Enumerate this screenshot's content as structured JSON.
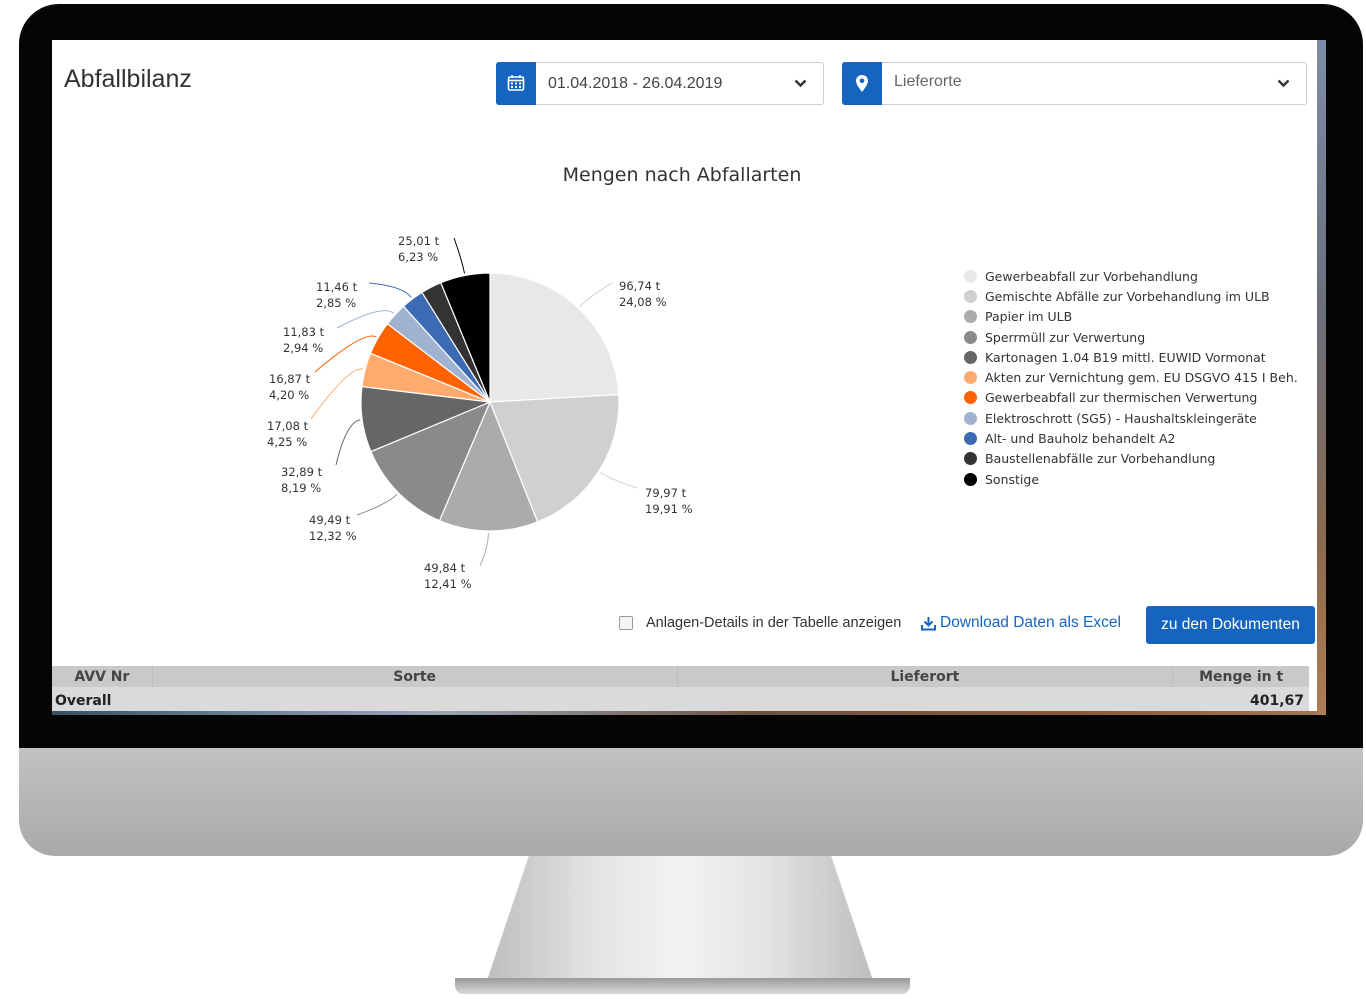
{
  "header": {
    "title": "Abfallbilanz",
    "date_range": "01.04.2018 - 26.04.2019",
    "location_placeholder": "Lieferorte"
  },
  "icons": {
    "date": "calendar-icon",
    "location": "map-pin-icon",
    "dropdown": "chevron-down-icon",
    "download": "download-icon"
  },
  "chart_data": {
    "type": "pie",
    "title": "Mengen nach Abfallarten",
    "legend_position": "right",
    "series": [
      {
        "name": "Gewerbeabfall zur Vorbehandlung",
        "value": 96.74,
        "label_value": "96,74 t",
        "label_percent": "24,08 %",
        "color": "#e8e8e8"
      },
      {
        "name": "Gemischte Abfälle zur Vorbehandlung im ULB",
        "value": 79.97,
        "label_value": "79,97 t",
        "label_percent": "19,91 %",
        "color": "#d0d0d0"
      },
      {
        "name": "Papier im ULB",
        "value": 49.84,
        "label_value": "49,84 t",
        "label_percent": "12,41 %",
        "color": "#ababab"
      },
      {
        "name": "Sperrmüll zur Verwertung",
        "value": 49.49,
        "label_value": "49,49 t",
        "label_percent": "12,32 %",
        "color": "#8a8a8a"
      },
      {
        "name": "Kartonagen 1.04 B19 mittl. EUWID Vormonat",
        "value": 32.89,
        "label_value": "32,89 t",
        "label_percent": "8,19 %",
        "color": "#666666"
      },
      {
        "name": "Akten zur Vernichtung gem. EU DSGVO 415 I Beh.",
        "value": 17.08,
        "label_value": "17,08 t",
        "label_percent": "4,25 %",
        "color": "#ffab70"
      },
      {
        "name": "Gewerbeabfall zur thermischen Verwertung",
        "value": 16.87,
        "label_value": "16,87 t",
        "label_percent": "4,20 %",
        "color": "#ff6200"
      },
      {
        "name": "Elektroschrott (SG5) - Haushaltskleingeräte",
        "value": 11.83,
        "label_value": "11,83 t",
        "label_percent": "2,94 %",
        "color": "#9fb3d1"
      },
      {
        "name": "Alt- und Bauholz behandelt A2",
        "value": 11.46,
        "label_value": "11,46 t",
        "label_percent": "2,85 %",
        "color": "#3d6ab5"
      },
      {
        "name": "Baustellenabfälle zur Vorbehandlung",
        "value": 10.49,
        "label_value": "",
        "label_percent": "",
        "color": "#333333"
      },
      {
        "name": "Sonstige",
        "value": 25.01,
        "label_value": "25,01 t",
        "label_percent": "6,23 %",
        "color": "#000000"
      }
    ]
  },
  "controls": {
    "details_checkbox_label": "Anlagen-Details in der Tabelle anzeigen",
    "details_checked": false,
    "download_label": "Download Daten als Excel",
    "documents_button": "zu den Dokumenten"
  },
  "table": {
    "columns": [
      "AVV Nr",
      "Sorte",
      "Lieferort",
      "Menge in t"
    ],
    "rows": [
      {
        "label": "Overall",
        "menge": "401,67"
      }
    ]
  },
  "colors": {
    "accent": "#1565c0",
    "table_header": "#c9c9c9",
    "table_row": "#dadada"
  }
}
